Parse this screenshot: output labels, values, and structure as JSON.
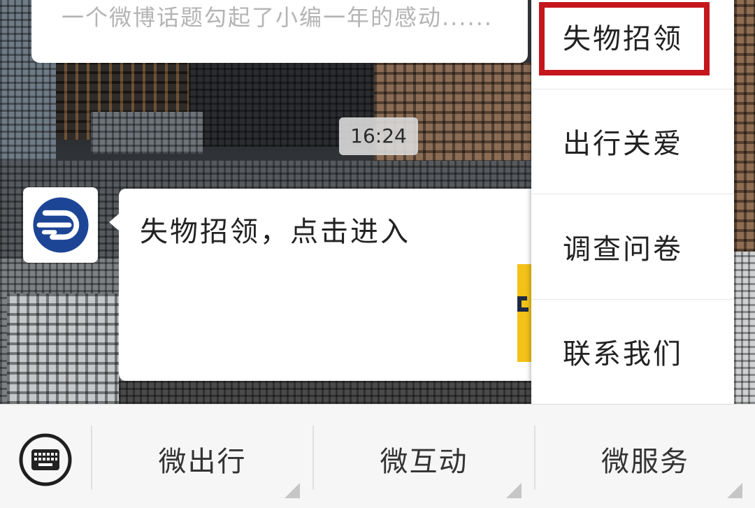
{
  "top_card": {
    "preview_text": "一个微博话题勾起了小编一年的感动......"
  },
  "chat": {
    "timestamp": "16:24",
    "message": {
      "text": "失物招领，点击进入",
      "avatar_icon": "metro-logo-icon"
    }
  },
  "popup_menu": {
    "items": [
      {
        "label": "失物招领",
        "highlighted": true
      },
      {
        "label": "出行关爱",
        "highlighted": false
      },
      {
        "label": "调查问卷",
        "highlighted": false
      },
      {
        "label": "联系我们",
        "highlighted": false
      }
    ]
  },
  "bottom_menu": {
    "keyboard_icon": "keyboard-icon",
    "items": [
      {
        "label": "微出行",
        "has_submenu": true
      },
      {
        "label": "微互动",
        "has_submenu": true
      },
      {
        "label": "微服务",
        "has_submenu": true
      }
    ]
  },
  "colors": {
    "highlight_border": "#c4161c",
    "logo_blue": "#1d4596",
    "accent_yellow": "#f2c218"
  }
}
